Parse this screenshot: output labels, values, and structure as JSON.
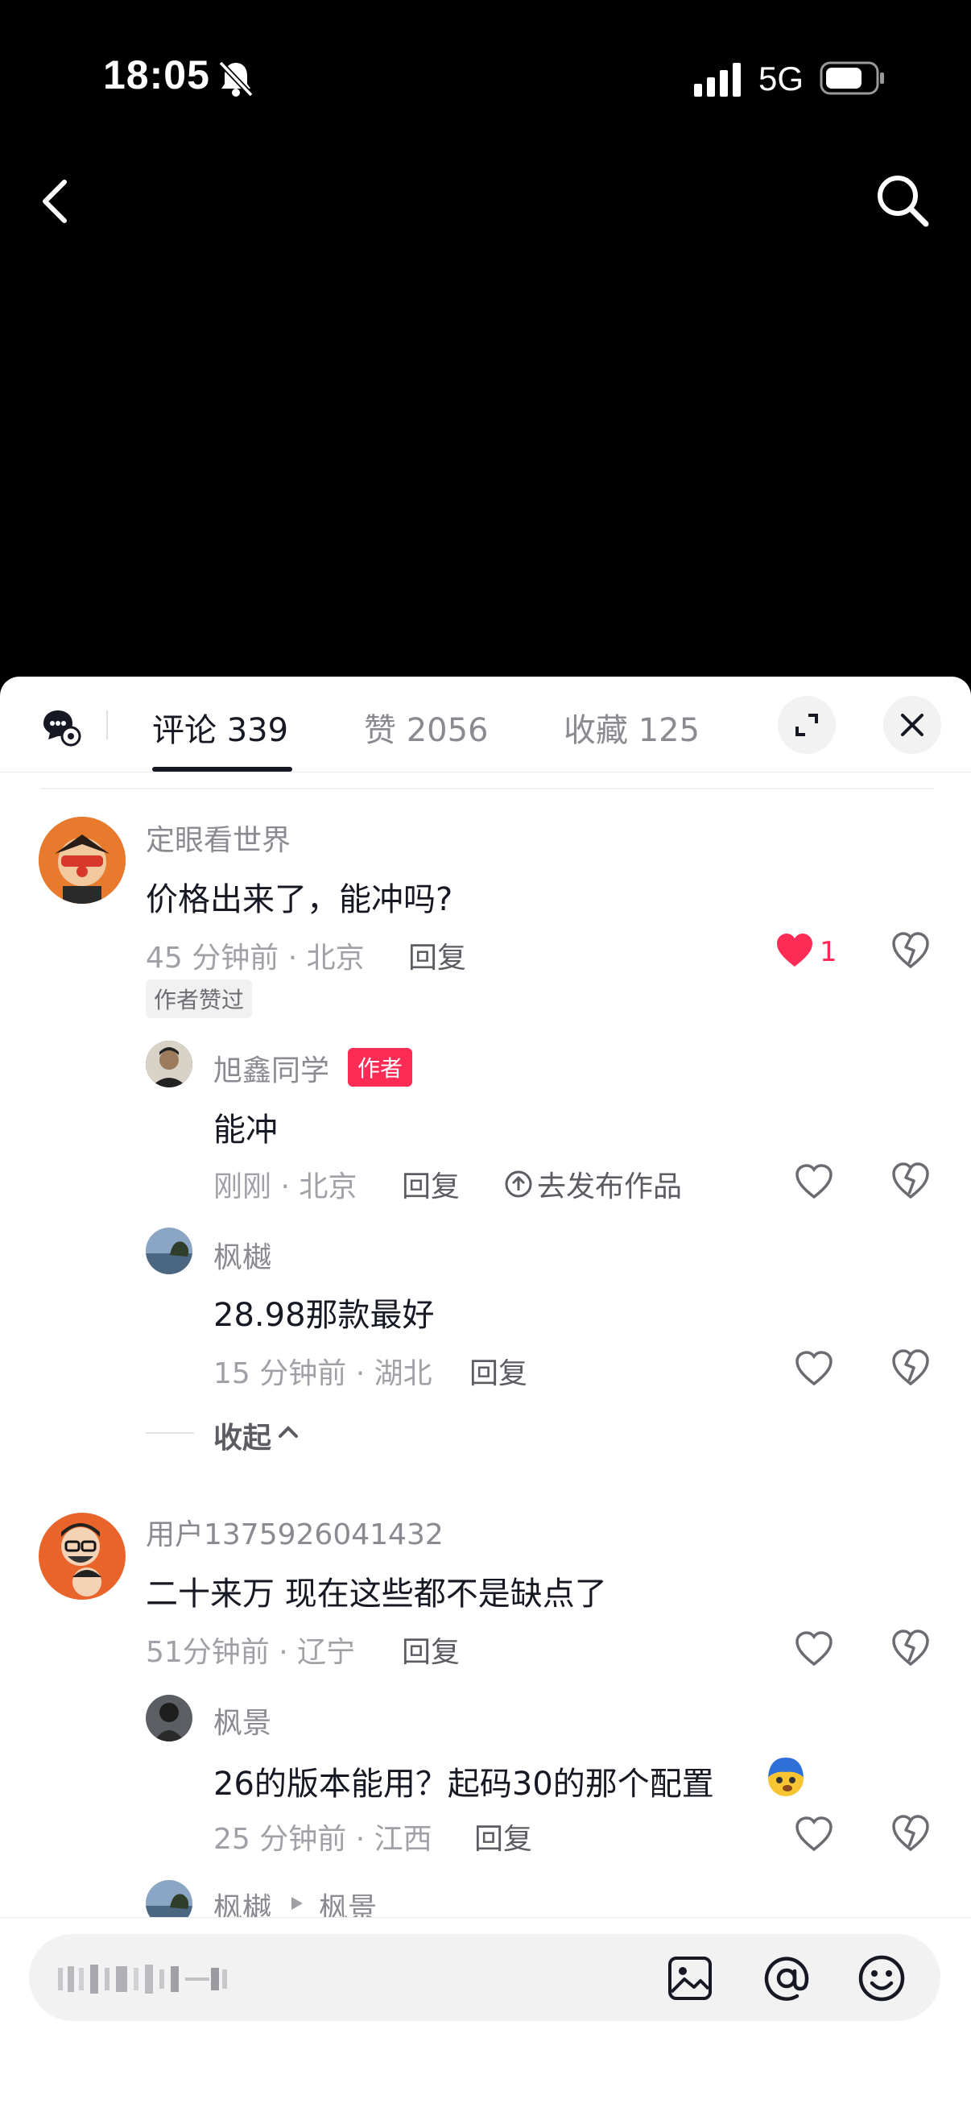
{
  "status_bar": {
    "time": "18:05",
    "network": "5G"
  },
  "tabs": {
    "comments": "评论 339",
    "likes": "赞 2056",
    "favorites": "收藏 125"
  },
  "comments": [
    {
      "name": "定眼看世界",
      "text": "价格出来了，能冲吗?",
      "meta": "45 分钟前 · 北京",
      "reply": "回复",
      "like_count": "1",
      "tag": "作者赞过",
      "replies": [
        {
          "name": "旭鑫同学",
          "badge": "作者",
          "text": "能冲",
          "meta": "刚刚 · 北京",
          "reply": "回复",
          "publish": "去发布作品"
        },
        {
          "name": "枫樾",
          "text": "28.98那款最好",
          "meta": "15 分钟前 · 湖北",
          "reply": "回复"
        }
      ],
      "collapse": "收起"
    },
    {
      "name": "用户1375926041432",
      "text": "二十来万  现在这些都不是缺点了",
      "meta": "51分钟前 · 辽宁",
      "reply": "回复",
      "replies": [
        {
          "name": "枫景",
          "text": "26的版本能用？起码30的那个配置",
          "meta": "25 分钟前 · 江西",
          "reply": "回复"
        },
        {
          "name": "枫樾",
          "reply_to": "枫景"
        }
      ]
    }
  ],
  "colors": {
    "accent": "#fe2c55",
    "text": "#161823",
    "muted": "#8a8b91"
  }
}
